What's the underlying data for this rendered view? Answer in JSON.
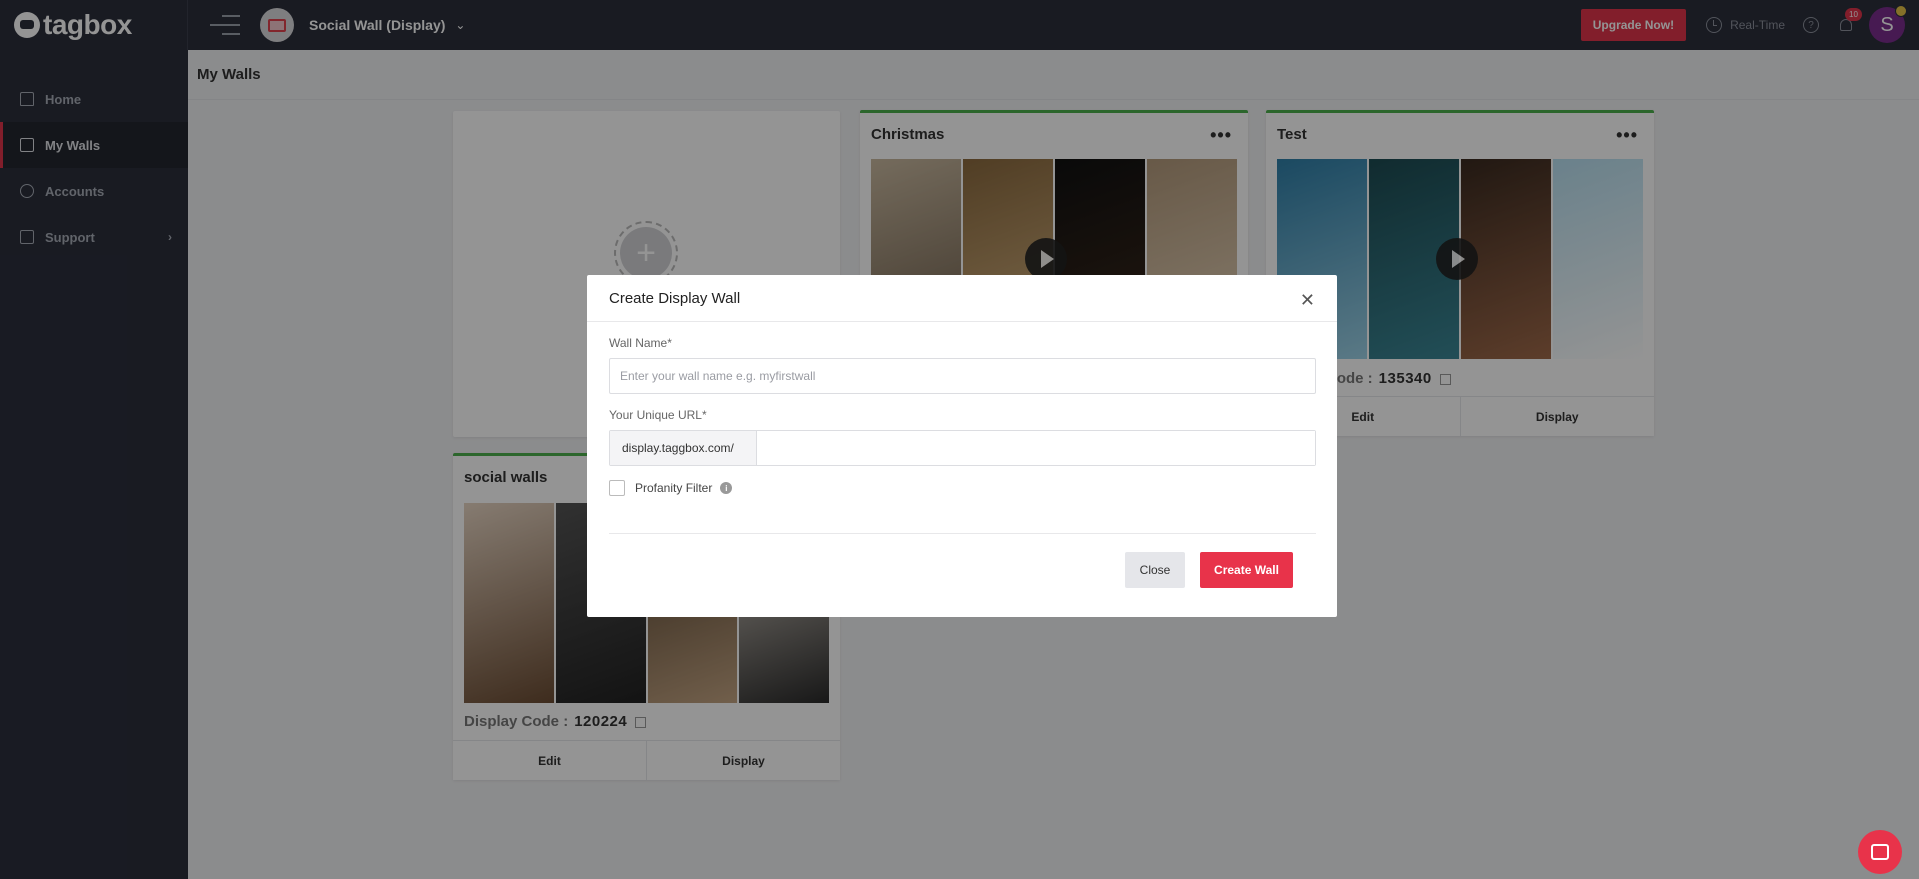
{
  "app": {
    "logo_text": "tagbox",
    "product_name": "Social Wall (Display)"
  },
  "header": {
    "upgrade_label": "Upgrade Now!",
    "realtime_label": "Real-Time",
    "notification_count": "10",
    "avatar_initial": "S"
  },
  "sidebar": {
    "items": [
      {
        "label": "Home",
        "icon": "home-icon"
      },
      {
        "label": "My Walls",
        "icon": "walls-icon",
        "active": true
      },
      {
        "label": "Accounts",
        "icon": "user-icon"
      },
      {
        "label": "Support",
        "icon": "support-icon"
      }
    ]
  },
  "page": {
    "title": "My Walls"
  },
  "walls": [
    {
      "title": "Christmas"
    },
    {
      "title": "Test",
      "code_label": "Code :",
      "code": "135340",
      "edit_label": "Edit",
      "display_label": "Display"
    },
    {
      "title": "social walls",
      "code_label": "Display Code :",
      "code": "120224",
      "edit_label": "Edit",
      "display_label": "Display"
    }
  ],
  "modal": {
    "title": "Create Display Wall",
    "wall_name_label": "Wall Name*",
    "wall_name_placeholder": "Enter your wall name e.g. myfirstwall",
    "url_label": "Your Unique URL*",
    "url_prefix": "display.taggbox.com/",
    "profanity_label": "Profanity Filter",
    "close_label": "Close",
    "create_label": "Create Wall"
  },
  "colors": {
    "accent": "#e8334a",
    "sidebar_bg": "#2b2f3c",
    "card_border": "#4db04d"
  }
}
